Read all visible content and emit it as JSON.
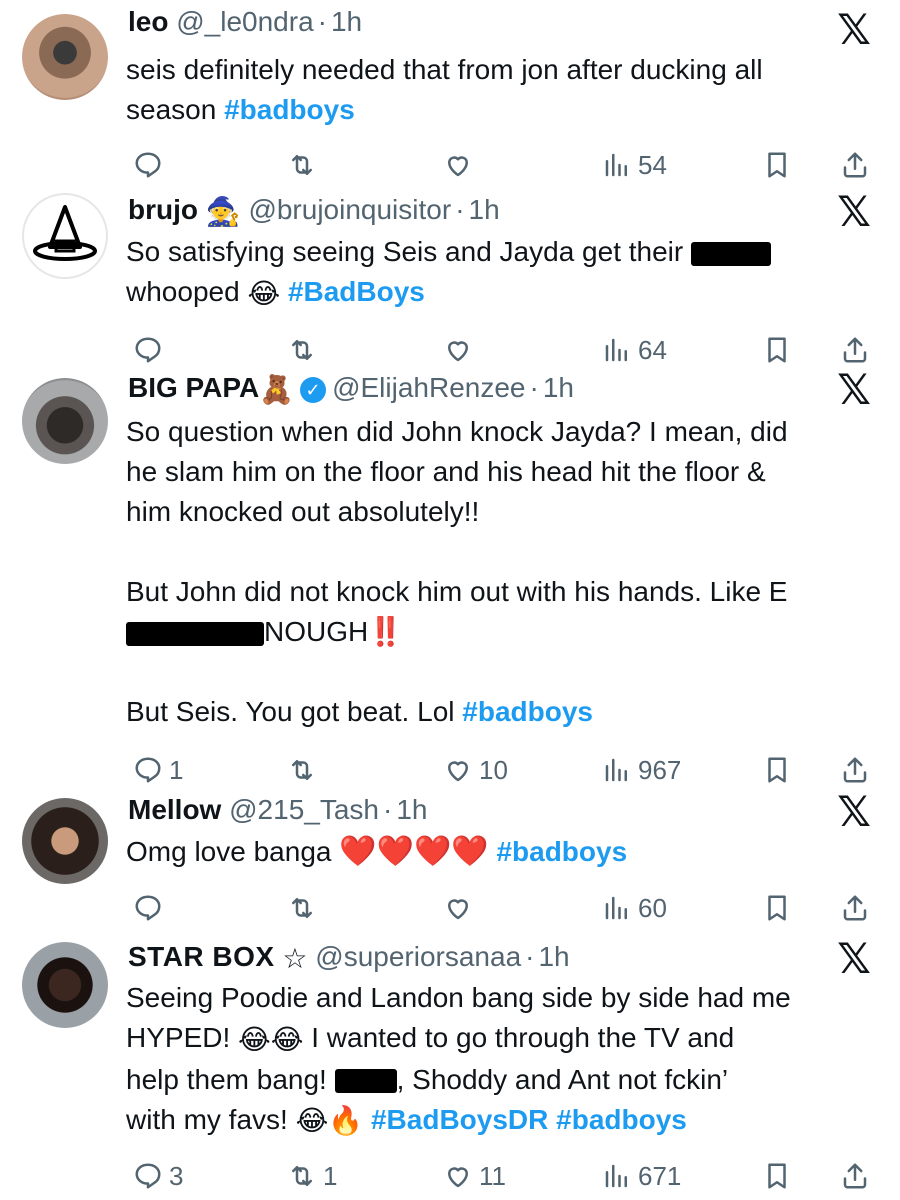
{
  "tweets": [
    {
      "name": "leo",
      "handle": "@_le0ndra",
      "time": "1h",
      "line1": "seis definitely needed that from jon after ducking all",
      "line2": "season",
      "tag": "#badboys",
      "replies": "",
      "retweets": "",
      "likes": "",
      "views": "54"
    },
    {
      "name": "brujo",
      "handle": "@brujoinquisitor",
      "time": "1h",
      "line1": "So satisfying seeing Seis and Jayda get their",
      "line2": "whooped",
      "tag": "#BadBoys",
      "replies": "",
      "retweets": "",
      "likes": "",
      "views": "64"
    },
    {
      "name": "BIG PAPA",
      "handle": "@ElijahRenzee",
      "time": "1h",
      "line1": "So question when did John knock Jayda? I mean, did",
      "line2": "he slam him on the floor and his head hit the floor &",
      "line3": "him knocked out absolutely!!",
      "line4": "But John did not knock him out with his hands. Like E",
      "line5": "NOUGH",
      "line6": "But Seis. You got beat. Lol",
      "tag": "#badboys",
      "replies": "1",
      "retweets": "",
      "likes": "10",
      "views": "967"
    },
    {
      "name": "Mellow",
      "handle": "@215_Tash",
      "time": "1h",
      "line1": "Omg love banga",
      "tag": "#badboys",
      "replies": "",
      "retweets": "",
      "likes": "",
      "views": "60"
    },
    {
      "name": "STAR BOX",
      "handle": "@superiorsanaa",
      "time": "1h",
      "line1": "Seeing Poodie and Landon bang side by side had me",
      "line2": "HYPED!",
      "line2b": "I wanted to go through the TV and",
      "line3": "help them bang!",
      "line3b": ", Shoddy and Ant not fckin’",
      "line4": "with my favs!",
      "tag1": "#BadBoysDR",
      "tag2": "#badboys",
      "replies": "3",
      "retweets": "1",
      "likes": "11",
      "views": "671"
    }
  ]
}
